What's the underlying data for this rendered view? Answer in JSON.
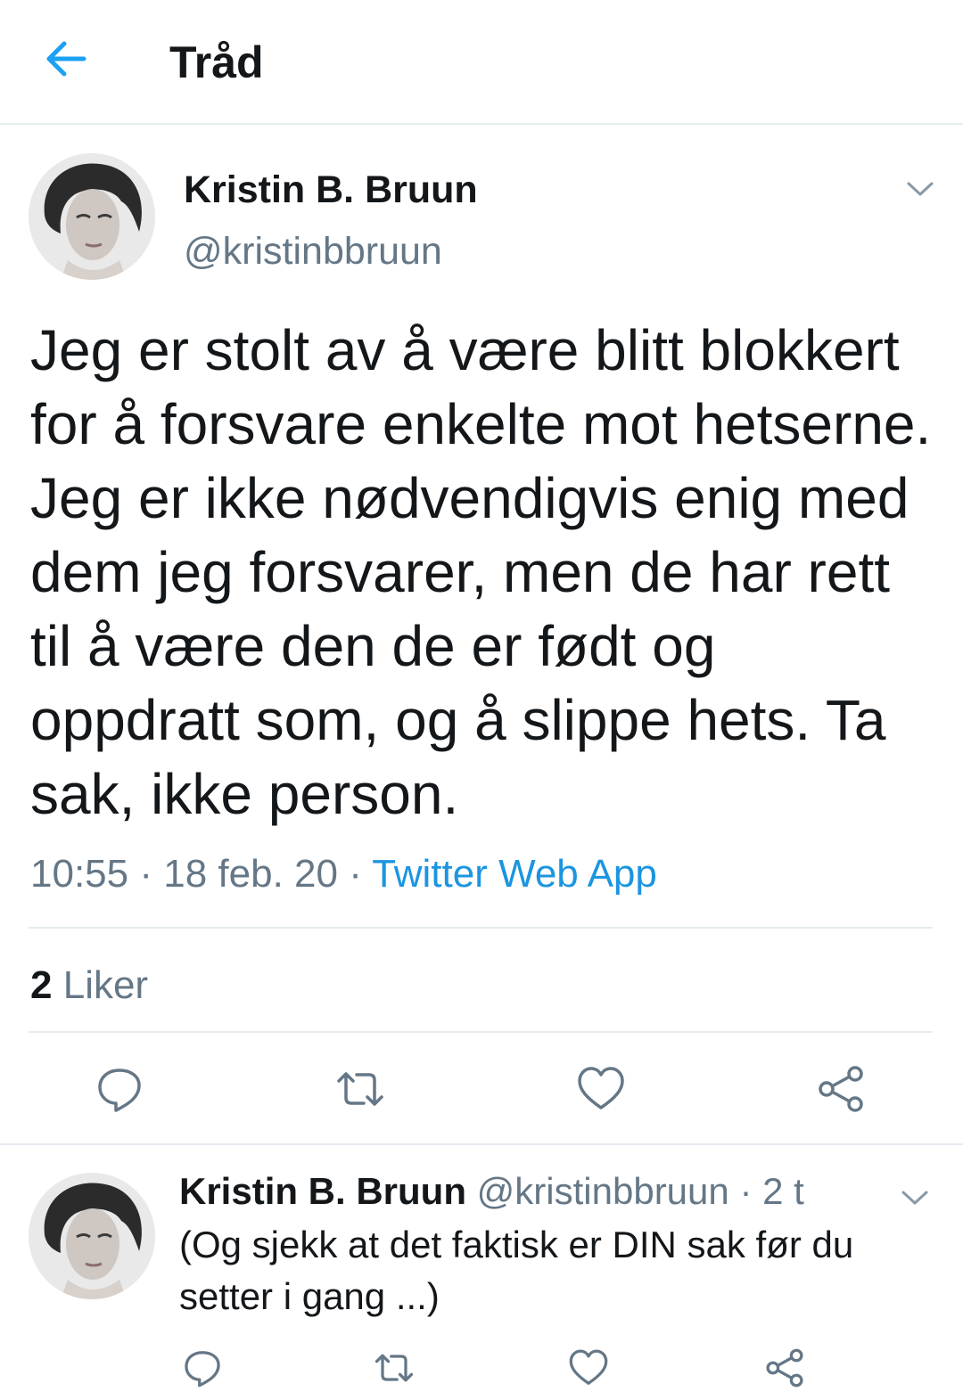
{
  "header": {
    "title": "Tråd"
  },
  "tweet": {
    "author_name": "Kristin B. Bruun",
    "author_handle": "@kristinbbruun",
    "text": "Jeg er stolt av å være blitt blokkert for å forsvare enkelte mot hetserne. Jeg er ikke nødvendigvis enig med dem jeg forsvarer, men de har rett til å være den de er født og oppdratt som, og å slippe hets. Ta sak, ikke person.",
    "time": "10:55",
    "date": "18 feb. 20",
    "separator": "·",
    "source": "Twitter Web App",
    "likes_count": "2",
    "likes_label": "Liker"
  },
  "reply": {
    "author_name": "Kristin B. Bruun",
    "author_handle": "@kristinbbruun",
    "age": "2 t",
    "separator": "·",
    "text": "(Og sjekk at det faktisk er DIN sak før du setter i gang ...)"
  },
  "icons": {
    "back": "arrow-left-icon",
    "more": "chevron-down-icon",
    "reply": "speech-bubble-icon",
    "retweet": "retweet-icon",
    "like": "heart-icon",
    "share": "share-icon"
  },
  "colors": {
    "accent": "#1b95e0",
    "text": "#14171a",
    "secondary": "#657786",
    "divider": "#e6ecf0"
  }
}
